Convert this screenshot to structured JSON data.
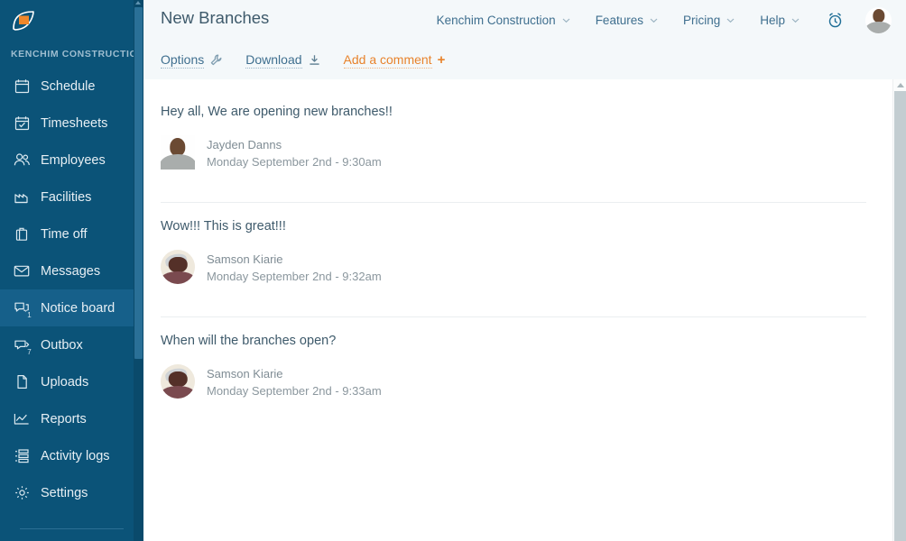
{
  "sidebar": {
    "logo_name": "leaf-logo",
    "org_label": "KENCHIM CONSTRUCTION",
    "items": [
      {
        "label": "Schedule",
        "icon": "calendar-icon",
        "badge": null,
        "active": false
      },
      {
        "label": "Timesheets",
        "icon": "calendar-check-icon",
        "badge": null,
        "active": false
      },
      {
        "label": "Employees",
        "icon": "users-icon",
        "badge": null,
        "active": false
      },
      {
        "label": "Facilities",
        "icon": "factory-icon",
        "badge": null,
        "active": false
      },
      {
        "label": "Time off",
        "icon": "briefcase-icon",
        "badge": null,
        "active": false
      },
      {
        "label": "Messages",
        "icon": "envelope-icon",
        "badge": null,
        "active": false
      },
      {
        "label": "Notice board",
        "icon": "chat-bubbles-icon",
        "badge": "1",
        "active": true
      },
      {
        "label": "Outbox",
        "icon": "outbox-icon",
        "badge": "7",
        "active": false
      },
      {
        "label": "Uploads",
        "icon": "file-icon",
        "badge": null,
        "active": false
      },
      {
        "label": "Reports",
        "icon": "line-chart-icon",
        "badge": null,
        "active": false
      },
      {
        "label": "Activity logs",
        "icon": "list-icon",
        "badge": null,
        "active": false
      },
      {
        "label": "Settings",
        "icon": "gear-icon",
        "badge": null,
        "active": false
      }
    ]
  },
  "header": {
    "page_title": "New Branches",
    "nav": [
      {
        "label": "Kenchim Construction",
        "has_caret": true
      },
      {
        "label": "Features",
        "has_caret": true
      },
      {
        "label": "Pricing",
        "has_caret": true
      },
      {
        "label": "Help",
        "has_caret": true
      }
    ],
    "alarm_icon": "alarm-clock-icon",
    "avatar": "user-avatar"
  },
  "actions": [
    {
      "label": "Options",
      "icon": "wrench-icon",
      "accent": false
    },
    {
      "label": "Download",
      "icon": "download-icon",
      "accent": false
    },
    {
      "label": "Add a comment",
      "icon": "plus-icon",
      "accent": true
    }
  ],
  "posts": [
    {
      "text": "Hey all, We are opening new branches!!",
      "author": "Jayden Danns",
      "date": "Monday September 2nd - 9:30am",
      "avatar_style": "square"
    },
    {
      "text": "Wow!!! This is great!!!",
      "author": "Samson Kiarie",
      "date": "Monday September 2nd - 9:32am",
      "avatar_style": "round"
    },
    {
      "text": "When will the branches open?",
      "author": "Samson Kiarie",
      "date": "Monday September 2nd - 9:33am",
      "avatar_style": "round"
    }
  ],
  "colors": {
    "sidebar_bg": "#0b5378",
    "sidebar_active": "#16608a",
    "accent": "#e8832c",
    "text_primary": "#3e5a6b",
    "link": "#3f6f8f",
    "header_bg": "#f4f8fa"
  }
}
